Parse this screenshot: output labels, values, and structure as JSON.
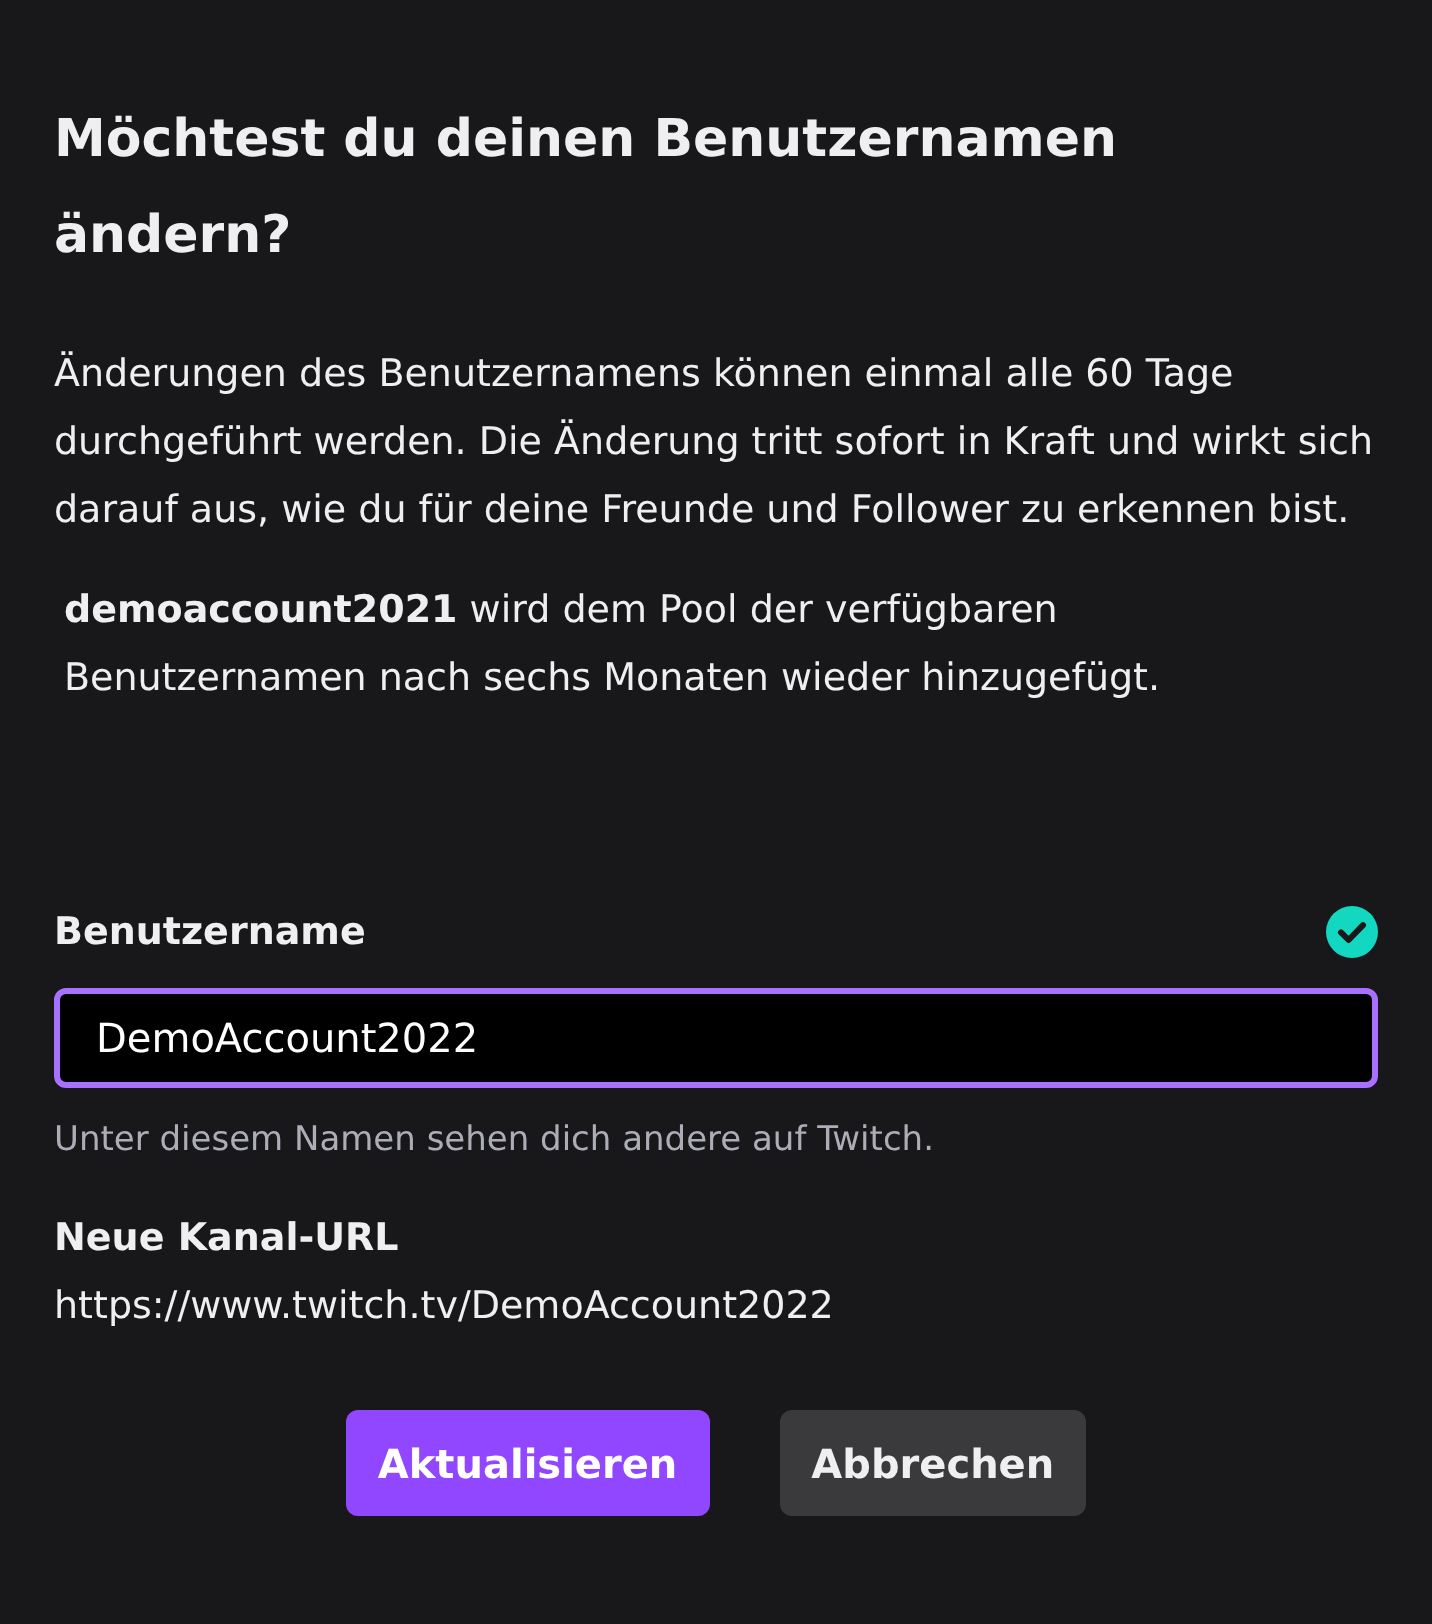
{
  "dialog": {
    "title": "Möchtest du deinen Benutzernamen ändern?",
    "description": "Änderungen des Benutzernamens können einmal alle 60 Tage durchgeführt werden. Die Änderung tritt sofort in Kraft und wirkt sich darauf aus, wie du für deine Freunde und Follower zu erkennen bist.",
    "note": "**demoaccount2021** wird dem Pool der verfügbaren Benutzernamen nach sechs Monaten wieder hinzugefügt."
  },
  "username_field": {
    "label": "Benutzername",
    "value": "DemoAccount2022",
    "valid": true,
    "focused": true,
    "hint": "Unter diesem Namen sehen dich andere auf Twitch."
  },
  "channel_url": {
    "label": "Neue Kanal-URL",
    "value": "https://www.twitch.tv/DemoAccount2022"
  },
  "buttons": [
    {
      "label": "Aktualisieren",
      "kind": "primary"
    },
    {
      "label": "Abbrechen",
      "kind": "secondary"
    }
  ]
}
